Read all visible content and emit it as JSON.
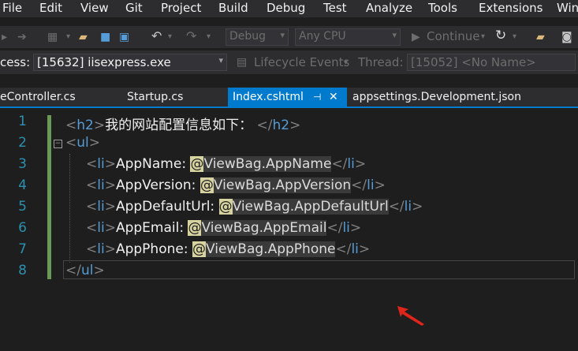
{
  "menu": [
    "File",
    "Edit",
    "View",
    "Git",
    "Project",
    "Build",
    "Debug",
    "Test",
    "Analyze",
    "Tools",
    "Extensions",
    "Win"
  ],
  "toolbar": {
    "config": "Debug",
    "platform": "Any CPU",
    "continue": "Continue"
  },
  "debugbar": {
    "process_label": "cess:",
    "process_value": "[15632] iisexpress.exe",
    "lifecycle": "Lifecycle Events",
    "thread_label": "Thread:",
    "thread_value": "[15052] <No Name>"
  },
  "tabs": [
    {
      "label": "eController.cs"
    },
    {
      "label": "Startup.cs"
    },
    {
      "label": "Index.cshtml",
      "active": true
    },
    {
      "label": "appsettings.Development.json"
    }
  ],
  "editor": {
    "line_numbers": [
      "1",
      "2",
      "3",
      "4",
      "5",
      "6",
      "7",
      "8"
    ],
    "lines": [
      {
        "open": "h2",
        "text": "我的网站配置信息如下：",
        "close": "h2"
      },
      {
        "open": "ul"
      },
      {
        "open": "li",
        "label": "AppName: ",
        "at": "@",
        "expr": "ViewBag.AppName",
        "close": "li"
      },
      {
        "open": "li",
        "label": "AppVersion: ",
        "at": "@",
        "expr": "ViewBag.AppVersion",
        "close": "li"
      },
      {
        "open": "li",
        "label": "AppDefaultUrl: ",
        "at": "@",
        "expr": "ViewBag.AppDefaultUrl",
        "close": "li"
      },
      {
        "open": "li",
        "label": "AppEmail: ",
        "at": "@",
        "expr": "ViewBag.AppEmail",
        "close": "li"
      },
      {
        "open": "li",
        "label": "AppPhone: ",
        "at": "@",
        "expr": "ViewBag.AppPhone",
        "close": "li"
      },
      {
        "close": "ul"
      }
    ]
  }
}
